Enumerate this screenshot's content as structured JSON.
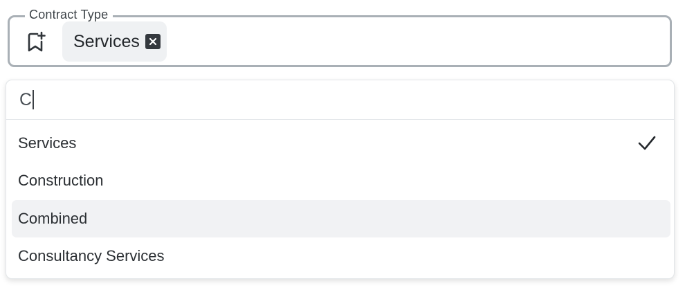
{
  "field": {
    "label": "Contract Type",
    "icon": "bookmark-plus-icon",
    "selected_chip": "Services",
    "chip_remove_icon": "close-box-icon"
  },
  "dropdown": {
    "search_value": "C",
    "options": [
      {
        "label": "Services",
        "selected": true,
        "highlighted": false
      },
      {
        "label": "Construction",
        "selected": false,
        "highlighted": false
      },
      {
        "label": "Combined",
        "selected": false,
        "highlighted": true
      },
      {
        "label": "Consultancy Services",
        "selected": false,
        "highlighted": false
      }
    ],
    "selected_icon": "checkmark-icon"
  },
  "colors": {
    "border": "#a9b0b6",
    "chip_bg": "#eff1f3",
    "highlight_bg": "#f1f2f4",
    "text": "#2b2f33"
  }
}
